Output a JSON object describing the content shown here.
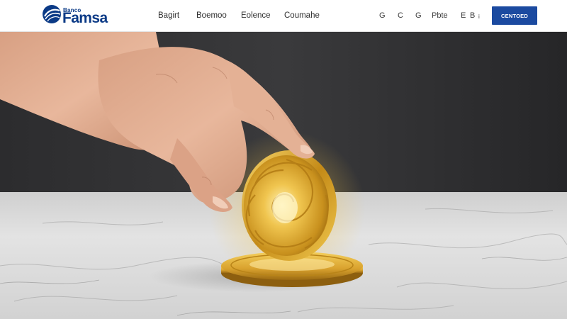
{
  "brand": {
    "name_small": "Banco",
    "name_big": "Famsa",
    "color": "#0b3a86"
  },
  "nav": {
    "items": [
      {
        "label": "Bagirt"
      },
      {
        "label": "Boemoo"
      },
      {
        "label": "Eolence"
      },
      {
        "label": "Coumahe"
      }
    ]
  },
  "utility": {
    "items": [
      {
        "label": "G"
      },
      {
        "label": "C"
      },
      {
        "label": "G"
      },
      {
        "label": "Pbte"
      },
      {
        "label": "E"
      },
      {
        "label": "B"
      },
      {
        "label": "i"
      }
    ]
  },
  "cta": {
    "label": "CENTOED",
    "color": "#1b4aa0"
  },
  "hero": {
    "subject": "hand placing gold coin on marble surface",
    "coin_color": "#e2b23a",
    "wall_color": "#2a2a2c",
    "marble_color": "#dcdcdc"
  }
}
